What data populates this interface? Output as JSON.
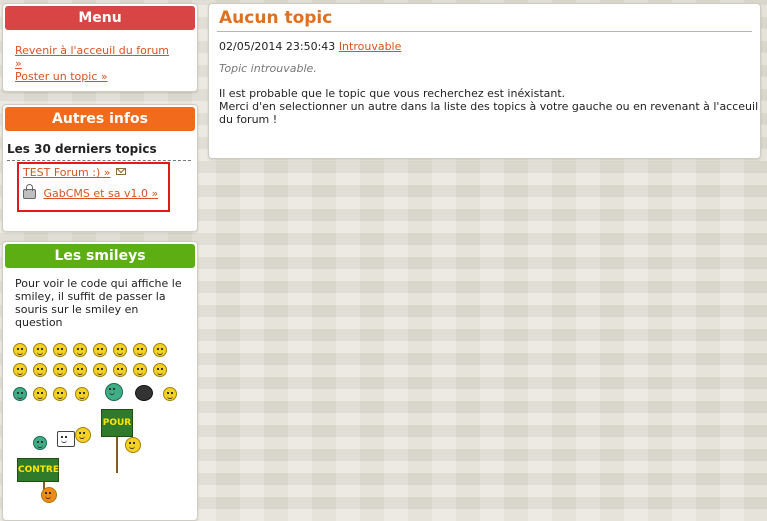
{
  "menu": {
    "title": "Menu",
    "links": [
      "Revenir à l'acceuil du forum",
      "»",
      "Poster un topic »"
    ],
    "color": "#d94444"
  },
  "infos": {
    "title": "Autres infos",
    "color": "#f26a1b",
    "section_title": "Les 30 derniers topics",
    "topics": [
      "TEST Forum :) »",
      "GabCMS et sa v1.0 »"
    ]
  },
  "smileys": {
    "title": "Les smileys",
    "color": "#5cae12",
    "description": "Pour voir le code qui affiche le smiley, il suffit de passer la souris sur le smiley en question",
    "signs": [
      "POUR",
      "CONTRE"
    ]
  },
  "main": {
    "title": "Aucun topic",
    "date": "02/05/2014 23:50:43",
    "author_link": "Introuvable",
    "note": "Topic introuvable.",
    "paragraph1": "Il est probable que le topic que vous recherchez est inéxistant.",
    "paragraph2": "Merci d'en selectionner un autre dans la liste des topics à votre gauche ou en revenant à l'acceuil du forum !"
  },
  "icons": [
    "mail-icon",
    "lock-icon",
    "smiley-icon"
  ]
}
